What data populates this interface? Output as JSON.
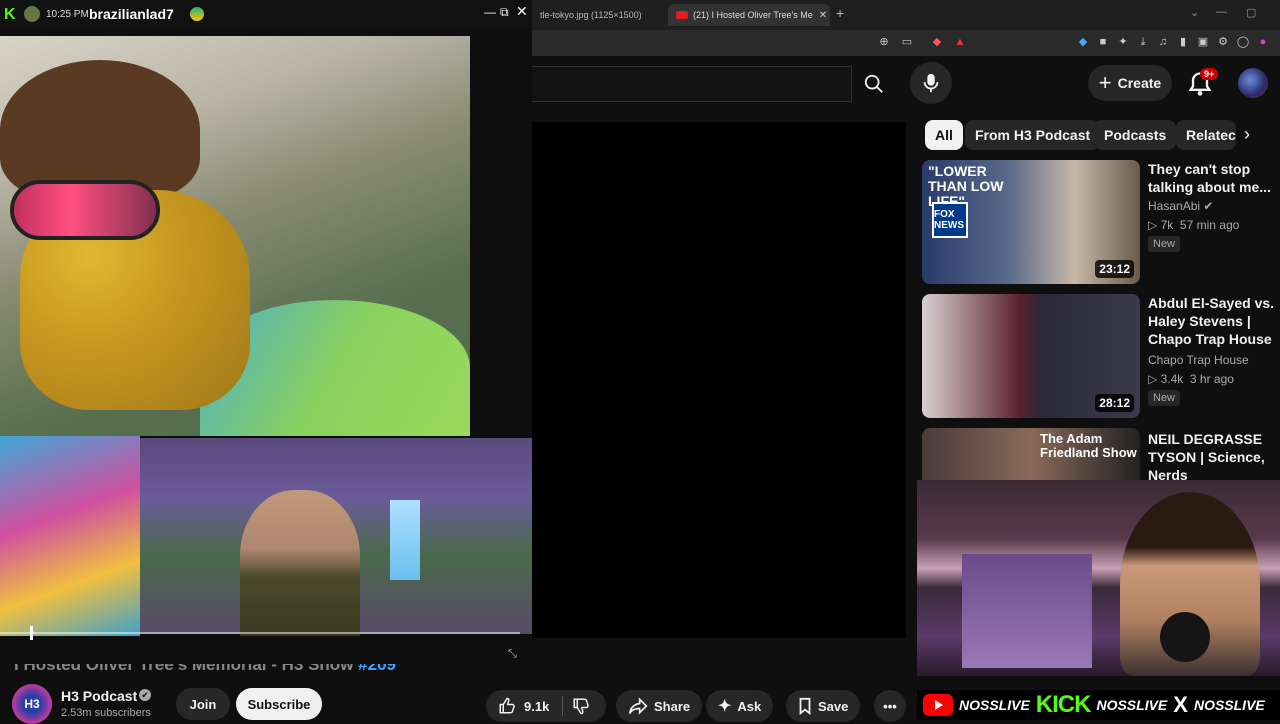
{
  "browser": {
    "tabs": [
      {
        "label": "tle-tokyo.jpg (1125×1500)"
      },
      {
        "label": "(21) I Hosted Oliver Tree's Me",
        "close": "✕"
      }
    ],
    "new_tab": "+"
  },
  "youtube": {
    "create_label": "Create",
    "notification_count": "9+",
    "chips": [
      "All",
      "From H3 Podcast",
      "Podcasts",
      "Relatec"
    ],
    "recommended": [
      {
        "thumb_text": "\"LOWER THAN LOW LIFE\"",
        "logo_text": "FOX NEWS",
        "duration": "23:12",
        "title": "They can't stop talking about me...",
        "channel": "HasanAbi",
        "views": "7k",
        "age": "57 min ago",
        "badge": "New"
      },
      {
        "duration": "28:12",
        "title": "Abdul El-Sayed vs. Haley Stevens | Chapo Trap House",
        "channel": "Chapo Trap House",
        "views": "3.4k",
        "age": "3 hr ago",
        "badge": "New"
      },
      {
        "thumb_text": "The Adam Friedland Show",
        "title": "NEIL DEGRASSE TYSON | Science, Nerds"
      }
    ],
    "video": {
      "title": "I Hosted Oliver Tree's Memorial - H3 Show ",
      "episode": "#209",
      "channel": "H3 Podcast",
      "channel_logo": "H3",
      "subscribers": "2.53m subscribers",
      "join": "Join",
      "subscribe": "Subscribe",
      "likes": "9.1k",
      "share": "Share",
      "ask": "Ask",
      "save": "Save"
    }
  },
  "popout": {
    "platform_logo": "K",
    "time": "10:25 PM",
    "username": "brazilianlad7"
  },
  "overlay": {
    "socials": [
      {
        "platform": "youtube",
        "handle": "NOSSLIVE"
      },
      {
        "platform": "kick",
        "logo": "KICK",
        "handle": "NOSSLIVE"
      },
      {
        "platform": "x",
        "logo": "X",
        "handle": "NOSSLIVE"
      }
    ]
  },
  "colors": {
    "kick_green": "#53fc18",
    "youtube_red": "#ff0000",
    "link_blue": "#3ea6ff"
  }
}
